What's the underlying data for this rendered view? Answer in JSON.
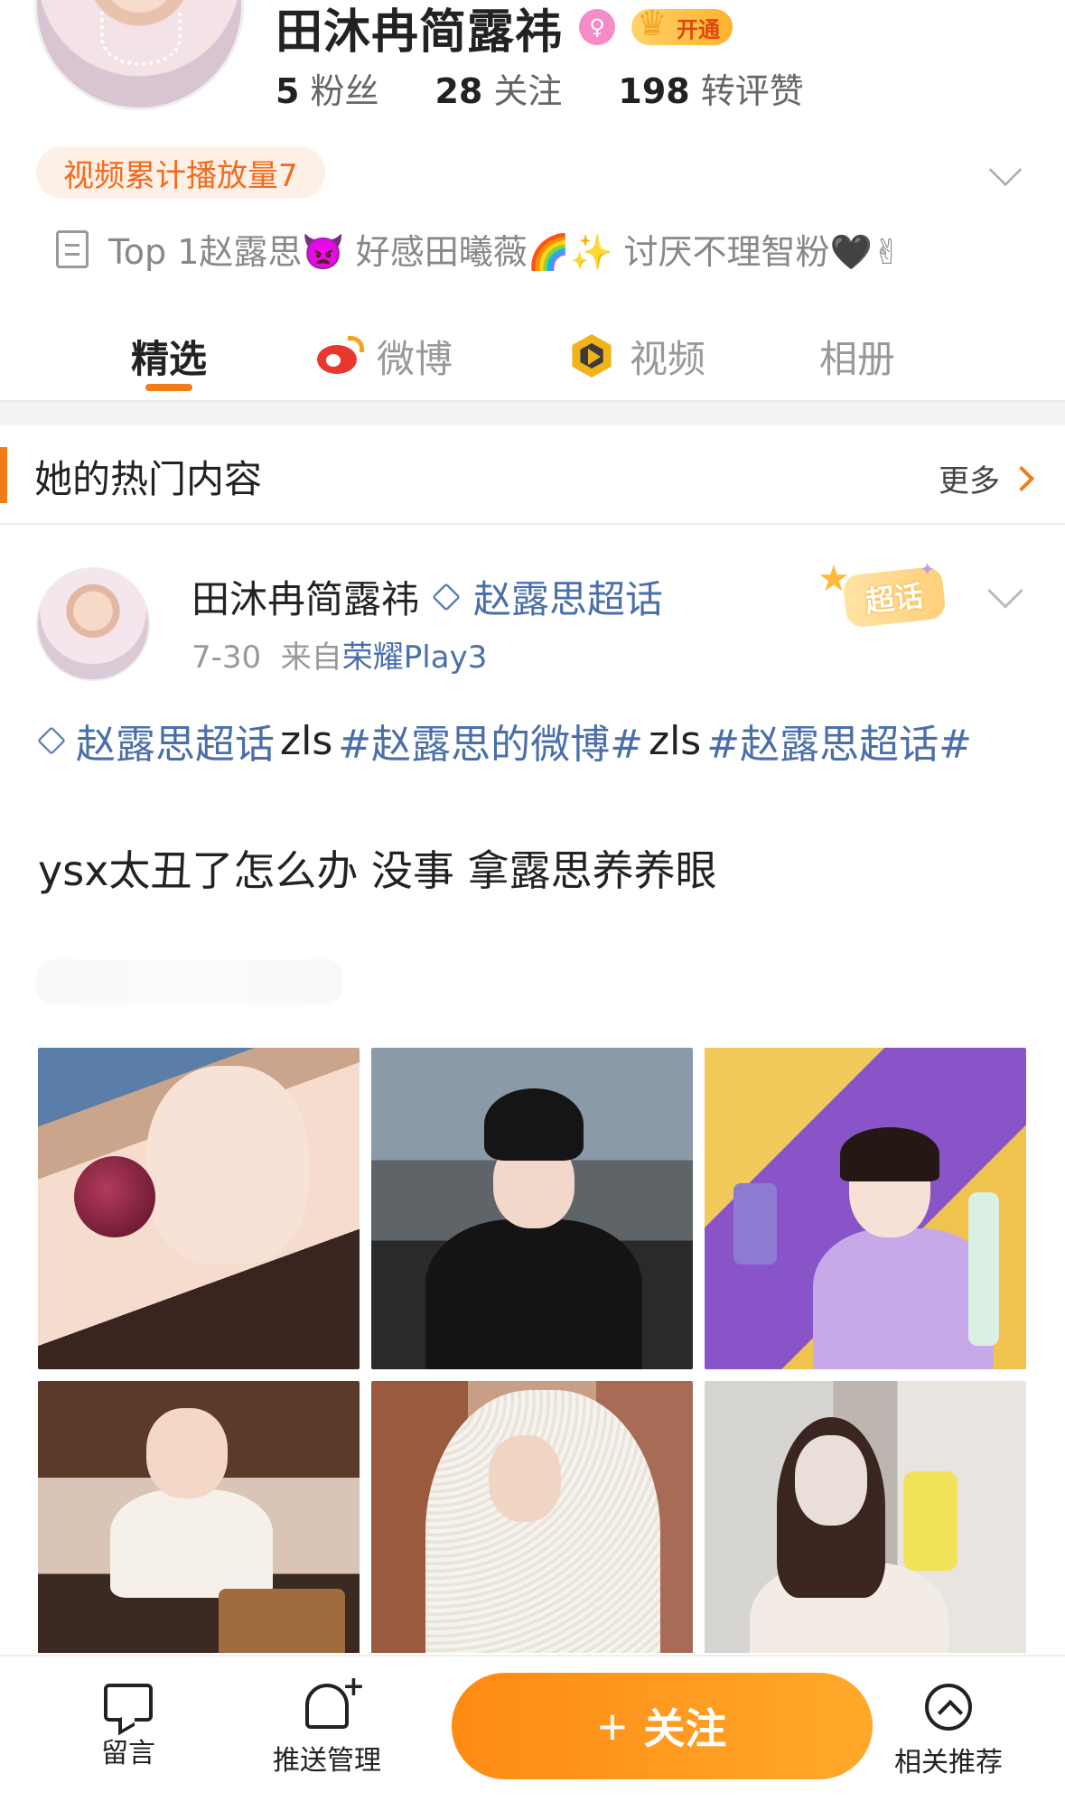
{
  "profile": {
    "name": "田沐冉简露祎",
    "vip_label": "开通",
    "stats": [
      {
        "value": "5",
        "label": "粉丝"
      },
      {
        "value": "28",
        "label": "关注"
      },
      {
        "value": "198",
        "label": "转评赞"
      }
    ],
    "play_count": "视频累计播放量7",
    "bio": "Top 1赵露思👿 好感田曦薇🌈✨ 讨厌不理智粉🖤✌"
  },
  "tabs": [
    {
      "label": "精选",
      "active": true
    },
    {
      "label": "微博",
      "icon": "weibo-icon"
    },
    {
      "label": "视频",
      "icon": "video-icon"
    },
    {
      "label": "相册"
    }
  ],
  "section": {
    "title": "她的热门内容",
    "more": "更多"
  },
  "post": {
    "author": "田沐冉简露祎",
    "topic": "赵露思超话",
    "date": "7-30",
    "source_prefix": "来自",
    "device": "荣耀Play3",
    "badge": "超话",
    "tags": [
      {
        "text": "赵露思超话",
        "type": "link"
      },
      {
        "text": " zls",
        "type": "plain"
      },
      {
        "text": "#赵露思的微博#",
        "type": "link"
      },
      {
        "text": " zls",
        "type": "plain"
      },
      {
        "text": "#赵露思超话#",
        "type": "link"
      }
    ],
    "text": "ysx太丑了怎么办 没事 拿露思养养眼",
    "photo_count": 6
  },
  "bottom_bar": {
    "message": "留言",
    "push": "推送管理",
    "follow_plus": "+",
    "follow": "关注",
    "related": "相关推荐"
  },
  "colors": {
    "accent": "#f27c18",
    "link": "#4a6fa8",
    "follow_gradient_start": "#ff8a14",
    "follow_gradient_end": "#ffa92b"
  }
}
